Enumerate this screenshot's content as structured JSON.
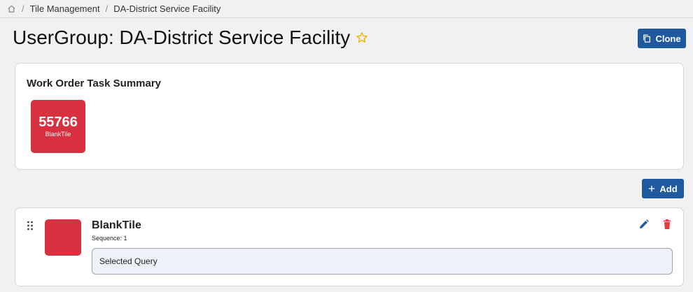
{
  "breadcrumb": {
    "items": [
      "Tile Management",
      "DA-District Service Facility"
    ],
    "separator": "/"
  },
  "page": {
    "title": "UserGroup: DA-District Service Facility"
  },
  "toolbar": {
    "clone_label": "Clone",
    "add_label": "Add"
  },
  "summary": {
    "title": "Work Order Task Summary",
    "tile": {
      "count": "55766",
      "label": "BlankTile"
    }
  },
  "tile_item": {
    "name": "BlankTile",
    "sequence": "Sequence: 1",
    "query_label": "Selected Query"
  },
  "colors": {
    "accent": "#1f5aa0",
    "tile": "#d9303f",
    "star": "#e6b800",
    "delete": "#e23b3b"
  },
  "icons": [
    "home-icon",
    "star-icon",
    "copy-icon",
    "plus-icon",
    "drag-handle-icon",
    "edit-icon",
    "delete-icon"
  ]
}
